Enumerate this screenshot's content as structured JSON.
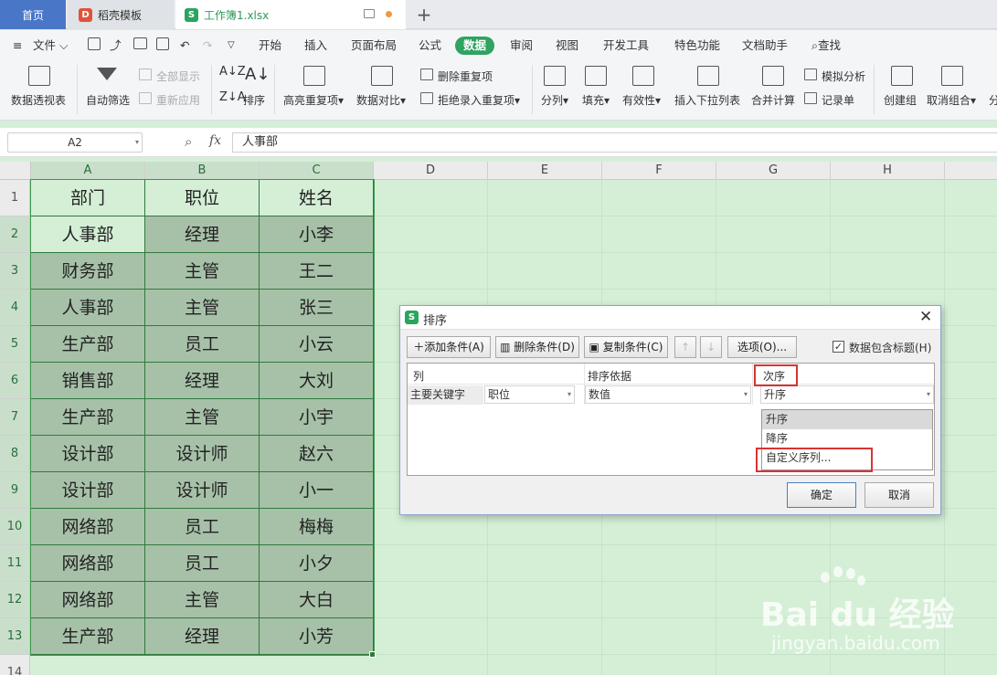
{
  "tabs": {
    "home": "首页",
    "template": "稻壳模板",
    "workbook": "工作簿1.xlsx",
    "workbook_icon": "S",
    "template_icon": "D",
    "plus": "+"
  },
  "menubar": {
    "file": "文件",
    "items": [
      "开始",
      "插入",
      "页面布局",
      "公式",
      "数据",
      "审阅",
      "视图",
      "开发工具",
      "特色功能",
      "文档助手"
    ],
    "active": "数据",
    "search": "查找"
  },
  "ribbon": {
    "pivot": "数据透视表",
    "autofilter": "自动筛选",
    "show_all": "全部显示",
    "reapply": "重新应用",
    "sort": "排序",
    "highlight_dup": "高亮重复项",
    "compare": "数据对比",
    "remove_dup": "删除重复项",
    "reject_dup": "拒绝录入重复项",
    "split": "分列",
    "fill": "填充",
    "validity": "有效性",
    "dropdown_list": "插入下拉列表",
    "consolidate": "合并计算",
    "simulate": "模拟分析",
    "records": "记录单",
    "group": "创建组",
    "ungroup": "取消组合",
    "more": "分"
  },
  "formula": {
    "cell_ref": "A2",
    "fx": "fx",
    "content": "人事部"
  },
  "sheet": {
    "columns": [
      "A",
      "B",
      "C",
      "D",
      "E",
      "F",
      "G",
      "H"
    ],
    "rows": [
      "1",
      "2",
      "3",
      "4",
      "5",
      "6",
      "7",
      "8",
      "9",
      "10",
      "11",
      "12",
      "13",
      "14"
    ],
    "header": [
      "部门",
      "职位",
      "姓名"
    ],
    "data": [
      [
        "人事部",
        "经理",
        "小李"
      ],
      [
        "财务部",
        "主管",
        "王二"
      ],
      [
        "人事部",
        "主管",
        "张三"
      ],
      [
        "生产部",
        "员工",
        "小云"
      ],
      [
        "销售部",
        "经理",
        "大刘"
      ],
      [
        "生产部",
        "主管",
        "小宇"
      ],
      [
        "设计部",
        "设计师",
        "赵六"
      ],
      [
        "设计部",
        "设计师",
        "小一"
      ],
      [
        "网络部",
        "员工",
        "梅梅"
      ],
      [
        "网络部",
        "员工",
        "小夕"
      ],
      [
        "网络部",
        "主管",
        "大白"
      ],
      [
        "生产部",
        "经理",
        "小芳"
      ]
    ]
  },
  "dialog": {
    "title": "排序",
    "icon": "S",
    "add": "添加条件(A)",
    "delete": "删除条件(D)",
    "copy": "复制条件(C)",
    "options": "选项(O)...",
    "has_header": "数据包含标题(H)",
    "has_header_checked": true,
    "col_header": "列",
    "basis_header": "排序依据",
    "order_header": "次序",
    "key_label": "主要关键字",
    "key_value": "职位",
    "basis_value": "数值",
    "order_value": "升序",
    "options_list": [
      "升序",
      "降序",
      "自定义序列..."
    ],
    "ok": "确定",
    "cancel": "取消"
  },
  "watermark": {
    "brand": "Bai du 经验",
    "url": "jingyan.baidu.com"
  },
  "colors": {
    "accent": "#2fa360",
    "home_tab": "#4a76c8",
    "sheet_bg": "#d4efd6",
    "selection": "#a7c1a8",
    "highlight_red": "#d93333"
  }
}
